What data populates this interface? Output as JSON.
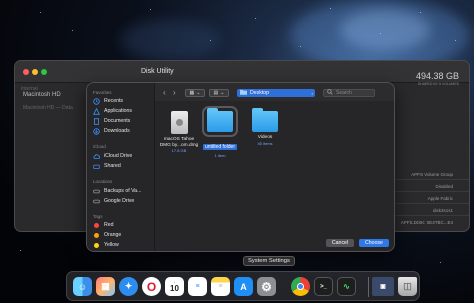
{
  "disk_utility": {
    "title": "Disk Utility",
    "sidebar_internal": "Internal",
    "sidebar_item": "Macintosh HD",
    "sidebar_sub": "Macintosh HD — Data",
    "capacity": "494.38 GB",
    "capacity_sub": "SHARED BY 5 VOLUMES",
    "info": [
      "APFS Volume Group",
      "Disabled",
      "Apple Fabric",
      "disk3s1s1",
      "APFS.DISK: 0E4TBC...E4"
    ]
  },
  "dialog": {
    "sidebar": {
      "favorites_header": "Favorites",
      "favorites": [
        {
          "label": "Recents",
          "icon": "clock-icon"
        },
        {
          "label": "Applications",
          "icon": "applications-icon"
        },
        {
          "label": "Documents",
          "icon": "document-icon"
        },
        {
          "label": "Downloads",
          "icon": "download-icon"
        }
      ],
      "icloud_header": "iCloud",
      "icloud": [
        {
          "label": "iCloud Drive",
          "icon": "cloud-icon"
        },
        {
          "label": "Shared",
          "icon": "shared-folder-icon"
        }
      ],
      "locations_header": "Locations",
      "locations": [
        {
          "label": "Backups of Va...",
          "icon": "drive-icon"
        },
        {
          "label": "Google Drive",
          "icon": "drive-icon"
        }
      ],
      "tags_header": "Tags",
      "tags": [
        {
          "label": "Red",
          "color": "#ff453a"
        },
        {
          "label": "Orange",
          "color": "#ff9f0a"
        },
        {
          "label": "Yellow",
          "color": "#ffd60a"
        }
      ]
    },
    "toolbar": {
      "location": "Desktop",
      "search_placeholder": "Search"
    },
    "files": [
      {
        "name": "macOS Tahoe",
        "name2": "DMG by...om.dmg",
        "sub": "17.8 GB",
        "kind": "disk"
      },
      {
        "name": "untitled folder",
        "sub": "1 item",
        "kind": "folder-selected"
      },
      {
        "name": "Videos",
        "sub": "45 items",
        "kind": "folder"
      }
    ],
    "buttons": {
      "cancel": "Cancel",
      "choose": "Choose"
    }
  },
  "tooltip": "System Settings",
  "dock": {
    "apps": [
      "Finder",
      "Launchpad",
      "Safari",
      "Opera",
      "Calendar",
      "Reminders",
      "Notes",
      "App Store",
      "System Settings",
      "Chrome",
      "Terminal",
      "Activity Monitor",
      "Preview",
      "Trash"
    ],
    "calendar_day": "10"
  }
}
